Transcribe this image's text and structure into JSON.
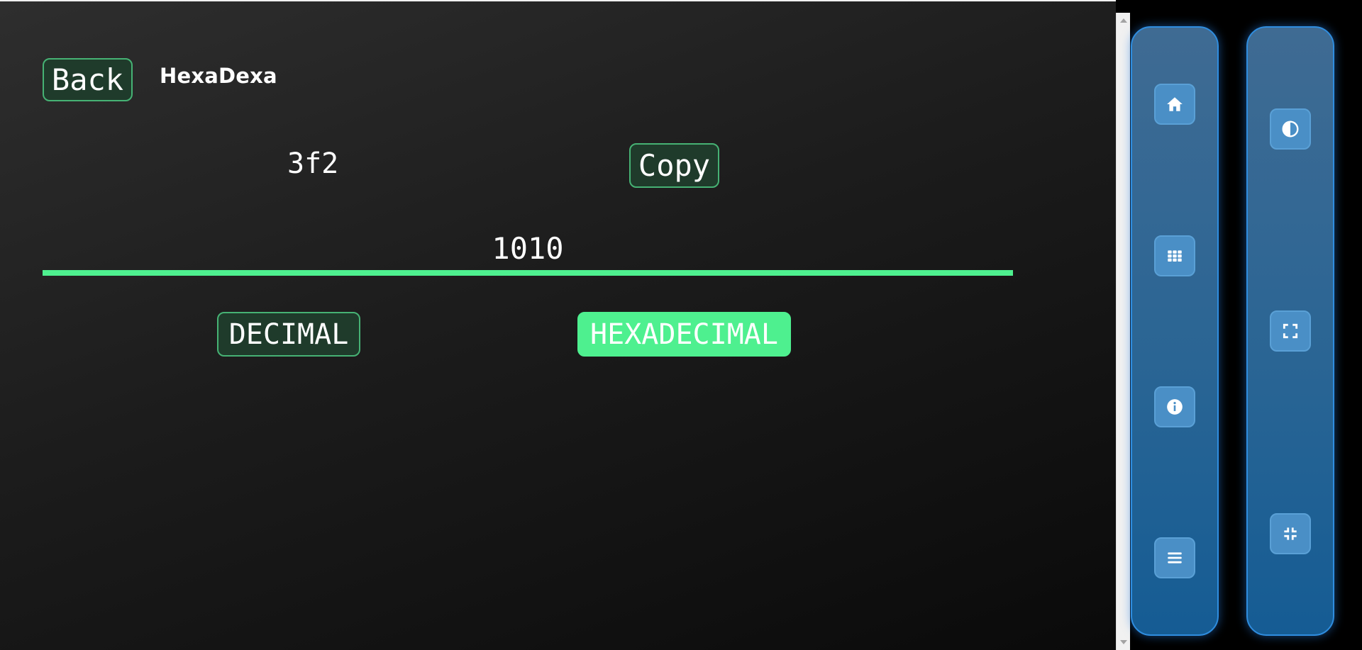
{
  "header": {
    "back_label": "Back",
    "brand": "HexaDexa"
  },
  "converter": {
    "result": "3f2",
    "copy_label": "Copy",
    "input_value": "1010",
    "modes": [
      {
        "label": "DECIMAL",
        "active": false
      },
      {
        "label": "HEXADECIMAL",
        "active": true
      }
    ]
  },
  "side_nav": {
    "left_icons": [
      "home-icon",
      "grid-icon",
      "info-icon",
      "menu-icon"
    ],
    "right_icons": [
      "contrast-icon",
      "fullscreen-icon",
      "exit-fullscreen-icon"
    ]
  },
  "colors": {
    "accent_green": "#4ef08f",
    "button_green_border": "#46b274",
    "panel_blue": "#2a6594",
    "panel_border": "#2f8ddf",
    "icon_button_blue": "#4a8fc6"
  }
}
